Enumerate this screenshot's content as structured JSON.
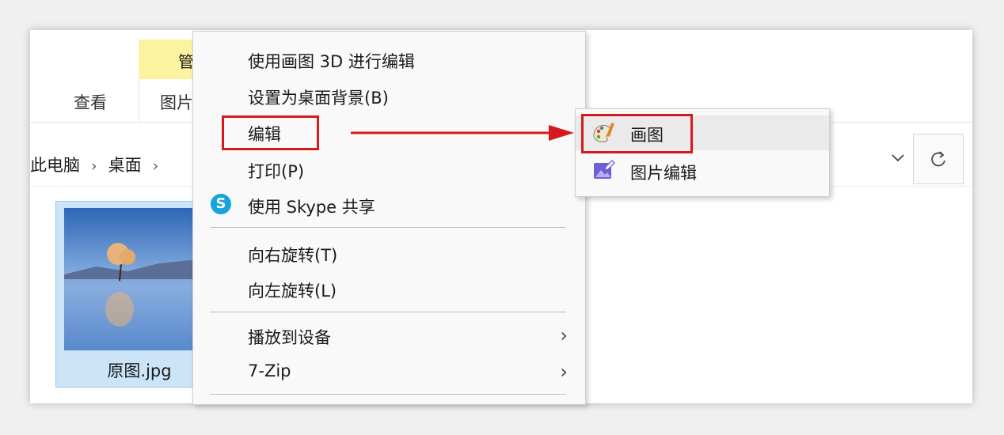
{
  "ribbon": {
    "manage_tab_label": "管",
    "tabs": [
      "查看",
      "图片"
    ]
  },
  "address": {
    "crumbs": [
      "此电脑",
      "桌面"
    ],
    "separator": "›"
  },
  "file": {
    "name": "原图.jpg"
  },
  "context_menu": {
    "items": [
      {
        "label": "使用画图 3D 进行编辑"
      },
      {
        "label": "设置为桌面背景(B)"
      },
      {
        "label": "编辑"
      },
      {
        "label": "打印(P)"
      },
      {
        "label": "使用 Skype 共享",
        "icon": "skype-icon"
      },
      {
        "label": "向右旋转(T)"
      },
      {
        "label": "向左旋转(L)"
      },
      {
        "label": "播放到设备",
        "submenu": true
      },
      {
        "label": "7-Zip",
        "submenu": true
      }
    ],
    "skype_glyph": "S",
    "submenu_arrow": "›"
  },
  "submenu": {
    "items": [
      {
        "label": "画图",
        "icon": "paint-icon"
      },
      {
        "label": "图片编辑",
        "icon": "photo-edit-icon"
      }
    ]
  },
  "colors": {
    "highlight_red": "#d5191c",
    "selection_blue": "#cce4f7",
    "context_tab_yellow": "#fbf3a0"
  }
}
